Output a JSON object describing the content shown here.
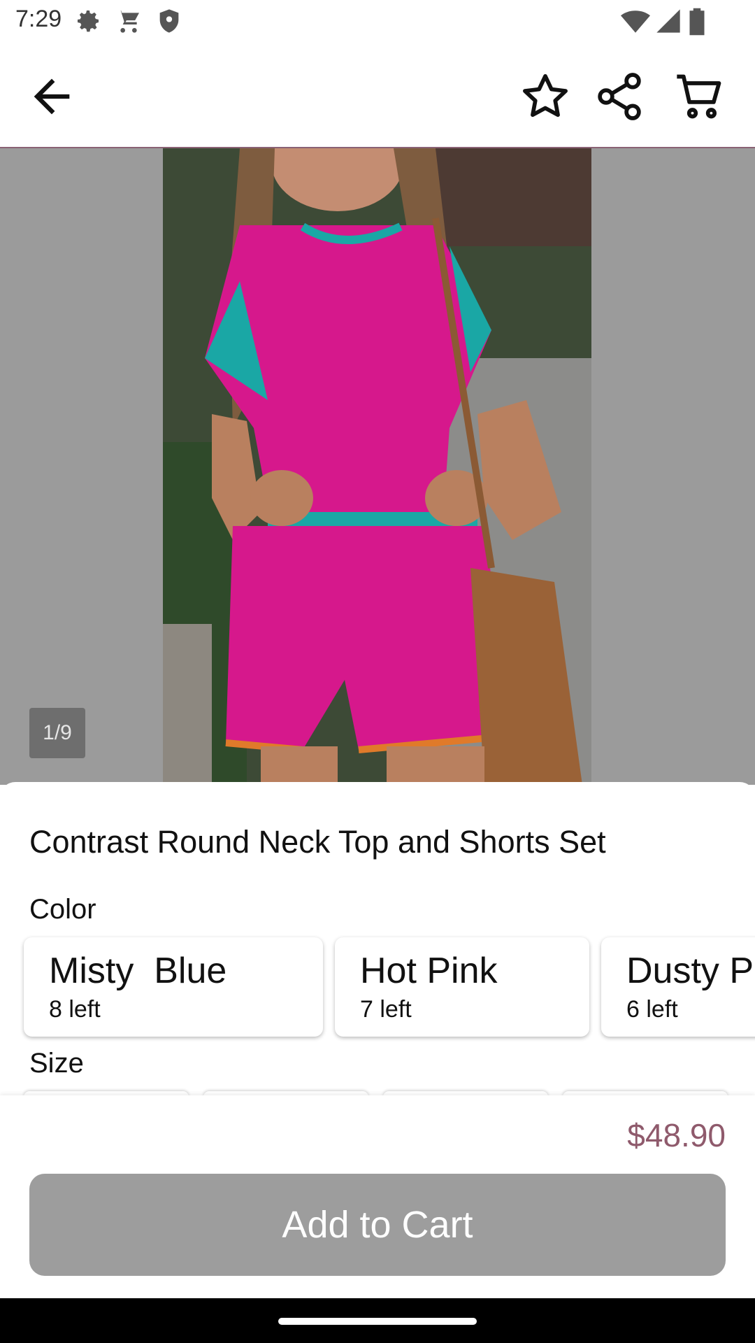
{
  "status_bar": {
    "time": "7:29",
    "left_icons": [
      "gear-icon",
      "cart-icon",
      "shield-icon"
    ],
    "right_icons": [
      "wifi-icon",
      "signal-icon",
      "battery-icon"
    ]
  },
  "app_bar": {
    "icons": [
      "back-arrow-icon",
      "star-icon",
      "share-icon",
      "cart-icon"
    ]
  },
  "gallery": {
    "counter": "1/9"
  },
  "product": {
    "title": "Contrast Round Neck Top and Shorts Set",
    "color_label": "Color",
    "size_label": "Size",
    "colors": [
      {
        "name": "Misty  Blue",
        "stock": "8 left"
      },
      {
        "name": "Hot Pink",
        "stock": "7 left"
      },
      {
        "name": "Dusty P",
        "stock": "6 left"
      }
    ]
  },
  "footer": {
    "price": "$48.90",
    "add_to_cart": "Add to Cart"
  },
  "colors": {
    "accent": "#8f5a6c",
    "button_disabled": "#9d9d9d"
  }
}
